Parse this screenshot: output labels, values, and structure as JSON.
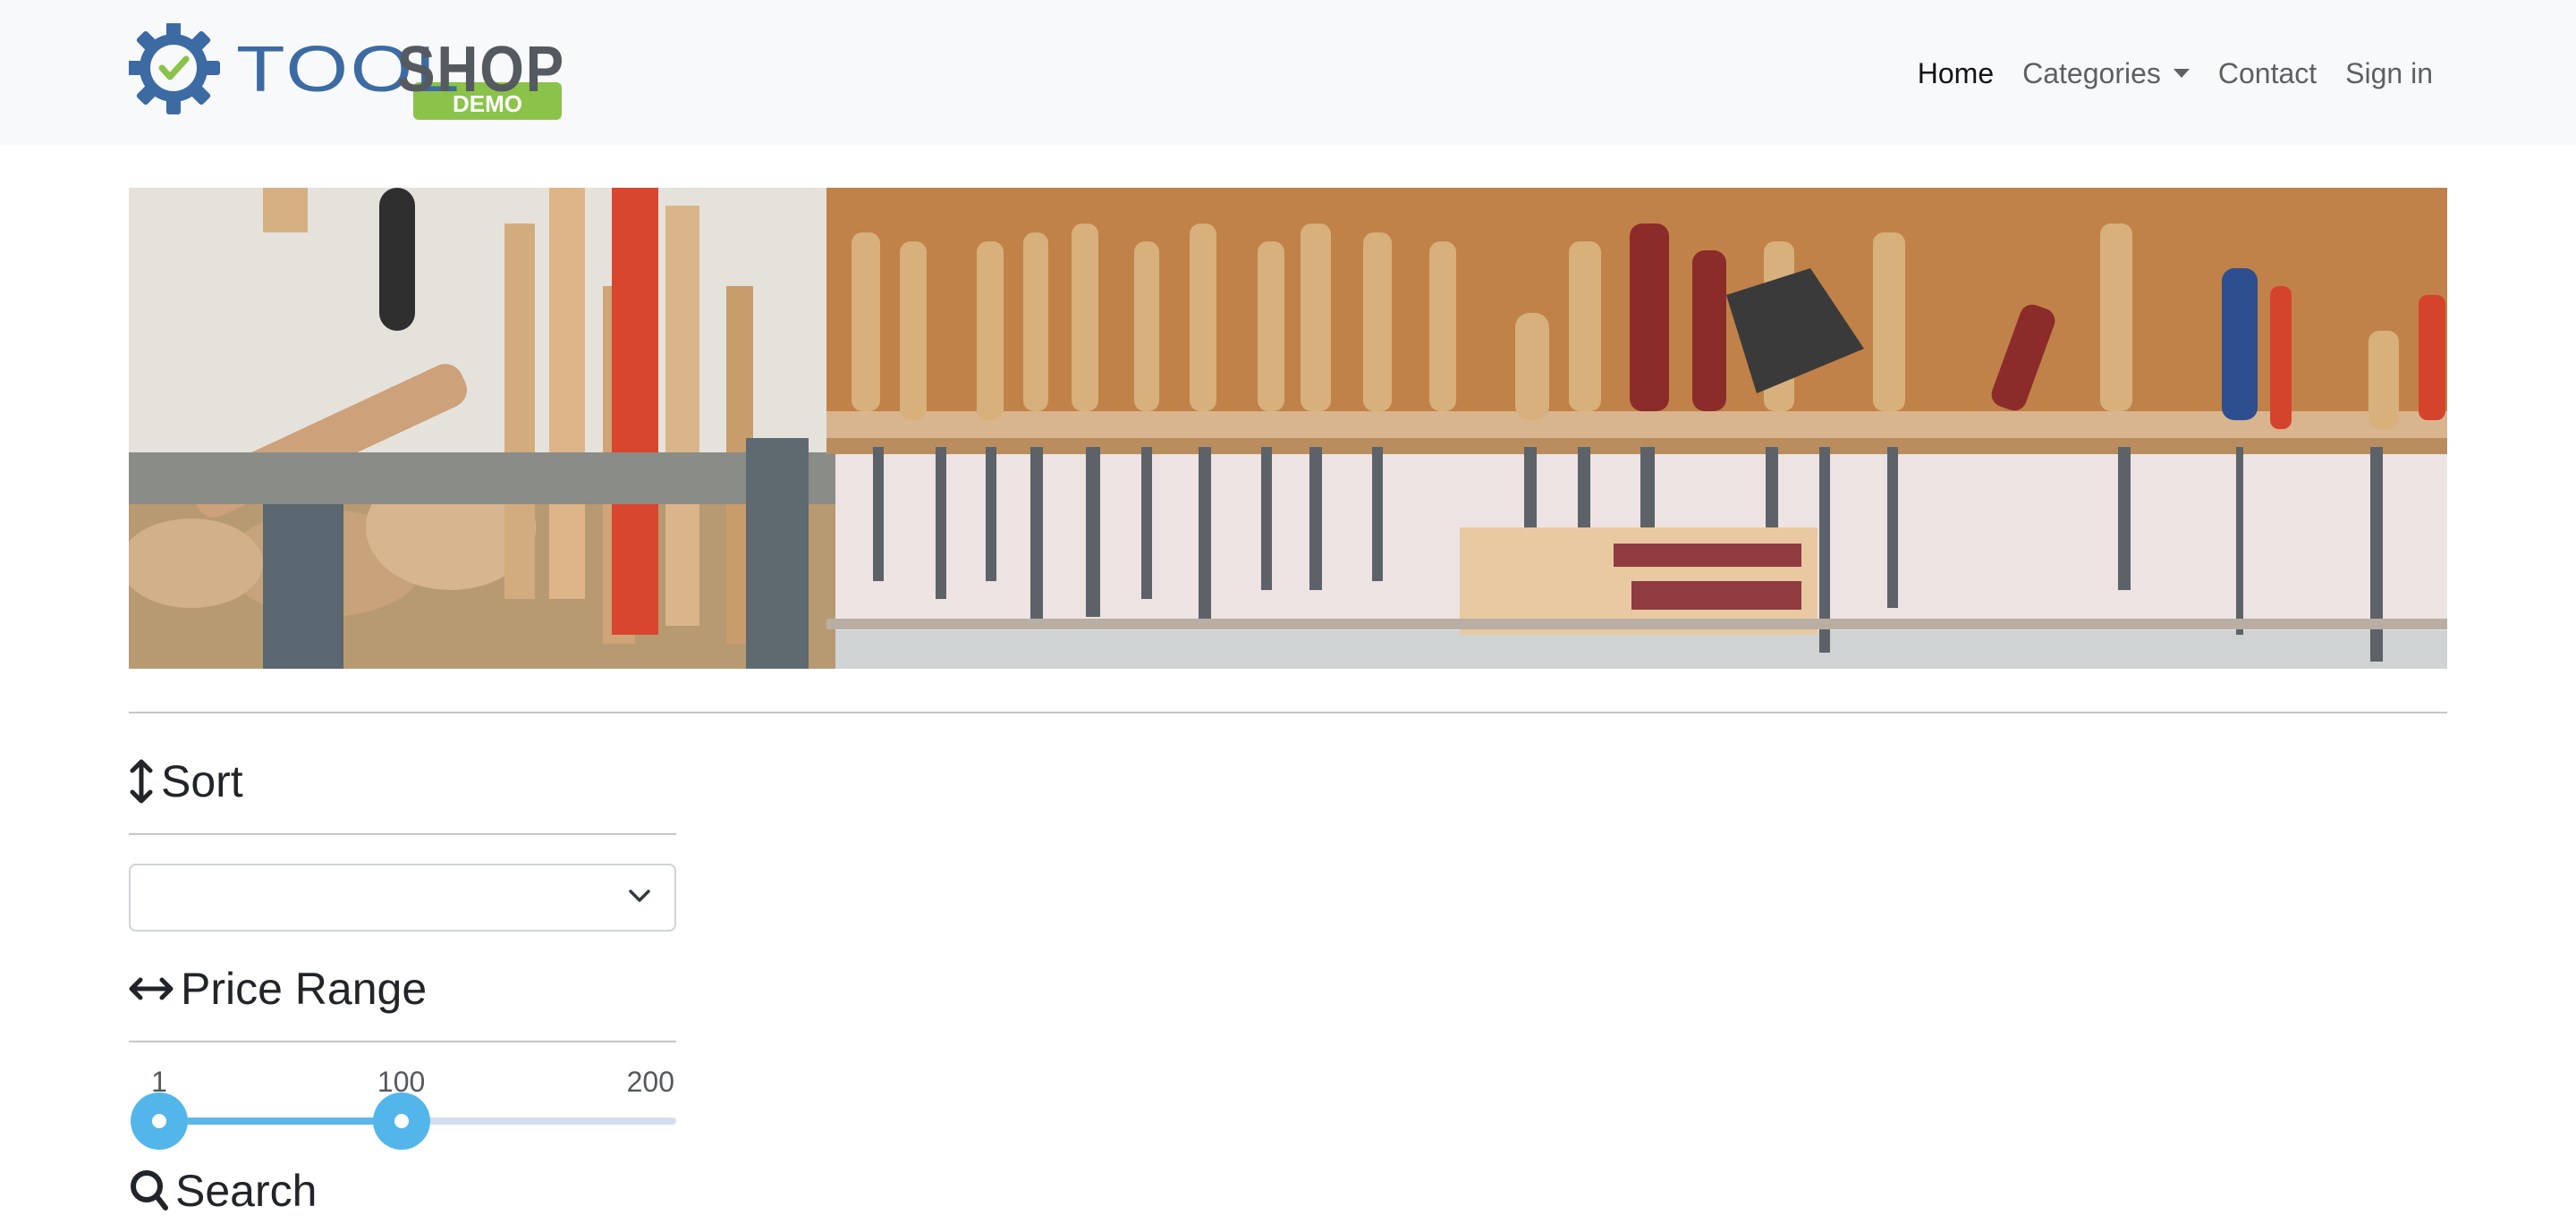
{
  "brand": {
    "name_part1": "TOOL",
    "name_part2": "SHOP",
    "badge": "DEMO"
  },
  "nav": {
    "home": "Home",
    "categories": "Categories",
    "contact": "Contact",
    "sign_in": "Sign in"
  },
  "banner": {
    "icon": "tools-wall-image"
  },
  "filters": {
    "sort": {
      "heading": "Sort",
      "icon": "sort-arrows-icon",
      "selected": ""
    },
    "price": {
      "heading": "Price Range",
      "icon": "horizontal-arrows-icon",
      "min": 1,
      "max": 200,
      "low": 1,
      "high": 100,
      "min_label": "1",
      "high_label": "100",
      "max_label": "200"
    },
    "search": {
      "heading": "Search",
      "icon": "search-icon"
    }
  },
  "colors": {
    "brand_gear": "#3c6aa3",
    "brand_check": "#8bc34a",
    "brand_badge": "#8bc34a",
    "slider_accent": "#53b6ea",
    "navbar_bg": "#f8f9fa"
  }
}
